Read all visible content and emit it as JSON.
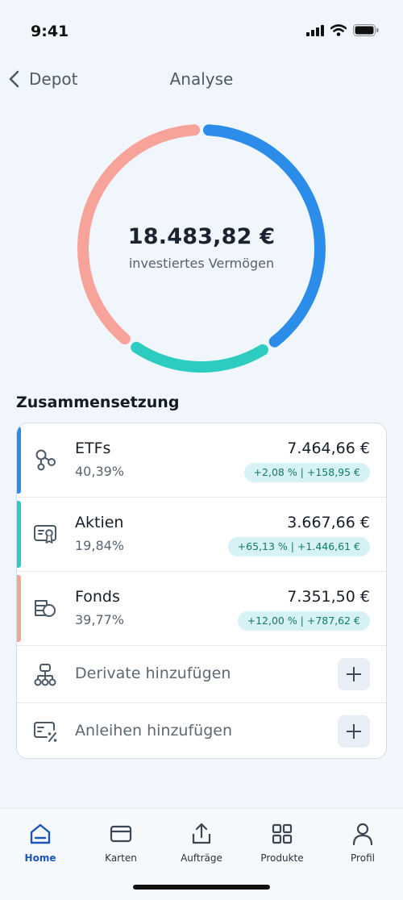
{
  "status": {
    "time": "9:41"
  },
  "nav": {
    "back_label": "Depot",
    "title": "Analyse"
  },
  "summary": {
    "total": "18.483,82 €",
    "subtitle": "investiertes Vermögen"
  },
  "section_title": "Zusammensetzung",
  "holdings": [
    {
      "name": "ETFs",
      "percent": "40,39%",
      "share": 40.39,
      "value": "7.464,66 €",
      "change": "+2,08 % | +158,95 €",
      "color": "#2b8de9",
      "icon": "etf-nodes-icon"
    },
    {
      "name": "Aktien",
      "percent": "19,84%",
      "share": 19.84,
      "value": "3.667,66 €",
      "change": "+65,13 % | +1.446,61 €",
      "color": "#2dccc1",
      "icon": "certificate-icon"
    },
    {
      "name": "Fonds",
      "percent": "39,77%",
      "share": 39.77,
      "value": "7.351,50 €",
      "change": "+12,00 % | +787,62 €",
      "color": "#f8a39a",
      "icon": "fund-icon"
    }
  ],
  "add_options": [
    {
      "label": "Derivate hinzufügen",
      "icon": "derivative-tree-icon"
    },
    {
      "label": "Anleihen hinzufügen",
      "icon": "bond-percent-icon"
    }
  ],
  "tabs": [
    {
      "label": "Home",
      "icon": "home-icon",
      "active": true
    },
    {
      "label": "Karten",
      "icon": "card-icon",
      "active": false
    },
    {
      "label": "Aufträge",
      "icon": "upload-icon",
      "active": false
    },
    {
      "label": "Produkte",
      "icon": "grid-icon",
      "active": false
    },
    {
      "label": "Profil",
      "icon": "user-icon",
      "active": false
    }
  ],
  "colors": {
    "accent": "#1a55b8",
    "badge_bg": "#d7f2f4",
    "badge_text": "#107a6b"
  }
}
